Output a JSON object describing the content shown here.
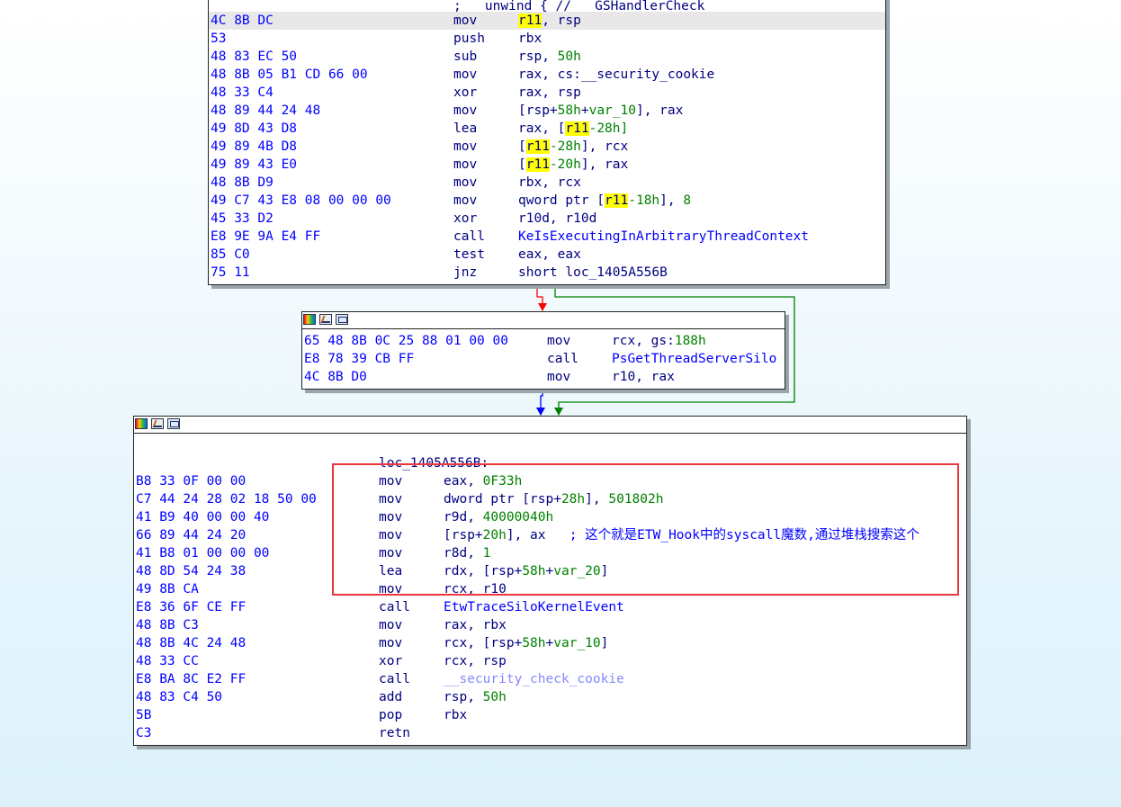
{
  "node1": {
    "partial_top": "; __unwind { // __GSHandlerCheck",
    "rows": [
      {
        "bytes": "4C 8B DC",
        "mnem": "mov",
        "op_parts": [
          {
            "t": "r11",
            "c": "hl"
          },
          {
            "t": ", rsp"
          }
        ]
      },
      {
        "bytes": "53",
        "mnem": "push",
        "op_parts": [
          {
            "t": "rbx"
          }
        ]
      },
      {
        "bytes": "48 83 EC 50",
        "mnem": "sub",
        "op_parts": [
          {
            "t": "rsp, "
          },
          {
            "t": "50h",
            "c": "g"
          }
        ]
      },
      {
        "bytes": "48 8B 05 B1 CD 66 00",
        "mnem": "mov",
        "op_parts": [
          {
            "t": "rax, cs:__security_cookie"
          }
        ]
      },
      {
        "bytes": "48 33 C4",
        "mnem": "xor",
        "op_parts": [
          {
            "t": "rax, rsp"
          }
        ]
      },
      {
        "bytes": "48 89 44 24 48",
        "mnem": "mov",
        "op_parts": [
          {
            "t": "[rsp+"
          },
          {
            "t": "58h",
            "c": "g"
          },
          {
            "t": "+"
          },
          {
            "t": "var_10",
            "c": "g"
          },
          {
            "t": "], rax"
          }
        ]
      },
      {
        "bytes": "49 8D 43 D8",
        "mnem": "lea",
        "op_parts": [
          {
            "t": "rax, ["
          },
          {
            "t": "r11",
            "c": "hl"
          },
          {
            "t": "-28h]",
            "c": "g"
          }
        ]
      },
      {
        "bytes": "49 89 4B D8",
        "mnem": "mov",
        "op_parts": [
          {
            "t": "["
          },
          {
            "t": "r11",
            "c": "hl"
          },
          {
            "t": "-28h",
            "c": "g"
          },
          {
            "t": "], rcx"
          }
        ]
      },
      {
        "bytes": "49 89 43 E0",
        "mnem": "mov",
        "op_parts": [
          {
            "t": "["
          },
          {
            "t": "r11",
            "c": "hl"
          },
          {
            "t": "-20h",
            "c": "g"
          },
          {
            "t": "], rax"
          }
        ]
      },
      {
        "bytes": "48 8B D9",
        "mnem": "mov",
        "op_parts": [
          {
            "t": "rbx, rcx"
          }
        ]
      },
      {
        "bytes": "49 C7 43 E8 08 00 00 00",
        "mnem": "mov",
        "op_parts": [
          {
            "t": "qword ptr ["
          },
          {
            "t": "r11",
            "c": "hl"
          },
          {
            "t": "-18h",
            "c": "g"
          },
          {
            "t": "], "
          },
          {
            "t": "8",
            "c": "g"
          }
        ]
      },
      {
        "bytes": "45 33 D2",
        "mnem": "xor",
        "op_parts": [
          {
            "t": "r10d, r10d"
          }
        ]
      },
      {
        "bytes": "E8 9E 9A E4 FF",
        "mnem": "call",
        "op_parts": [
          {
            "t": "KeIsExecutingInArbitraryThreadContext",
            "c": "b"
          }
        ]
      },
      {
        "bytes": "85 C0",
        "mnem": "test",
        "op_parts": [
          {
            "t": "eax, eax"
          }
        ]
      },
      {
        "bytes": "75 11",
        "mnem": "jnz",
        "op_parts": [
          {
            "t": "short loc_1405A556B"
          }
        ]
      }
    ]
  },
  "node2": {
    "rows": [
      {
        "bytes": "65 48 8B 0C 25 88 01 00 00",
        "mnem": "mov",
        "op_parts": [
          {
            "t": "rcx, gs:"
          },
          {
            "t": "188h",
            "c": "g"
          }
        ]
      },
      {
        "bytes": "E8 78 39 CB FF",
        "mnem": "call",
        "op_parts": [
          {
            "t": "PsGetThreadServerSilo",
            "c": "b"
          }
        ]
      },
      {
        "bytes": "4C 8B D0",
        "mnem": "mov",
        "op_parts": [
          {
            "t": "r10, rax"
          }
        ]
      }
    ]
  },
  "node3": {
    "label": "loc_1405A556B:",
    "rows": [
      {
        "bytes": "B8 33 0F 00 00",
        "mnem": "mov",
        "op_parts": [
          {
            "t": "eax, "
          },
          {
            "t": "0F33h",
            "c": "g"
          }
        ]
      },
      {
        "bytes": "C7 44 24 28 02 18 50 00",
        "mnem": "mov",
        "op_parts": [
          {
            "t": "dword ptr [rsp+"
          },
          {
            "t": "28h",
            "c": "g"
          },
          {
            "t": "], "
          },
          {
            "t": "501802h",
            "c": "g"
          }
        ]
      },
      {
        "bytes": "41 B9 40 00 00 40",
        "mnem": "mov",
        "op_parts": [
          {
            "t": "r9d, "
          },
          {
            "t": "40000040h",
            "c": "g"
          }
        ]
      },
      {
        "bytes": "66 89 44 24 20",
        "mnem": "mov",
        "op_parts": [
          {
            "t": "[rsp+"
          },
          {
            "t": "20h",
            "c": "g"
          },
          {
            "t": "], ax   "
          },
          {
            "t": "; 这个就是ETW_Hook中的syscall魔数,通过堆栈搜索这个",
            "c": "c"
          }
        ]
      },
      {
        "bytes": "41 B8 01 00 00 00",
        "mnem": "mov",
        "op_parts": [
          {
            "t": "r8d, "
          },
          {
            "t": "1",
            "c": "g"
          }
        ]
      },
      {
        "bytes": "48 8D 54 24 38",
        "mnem": "lea",
        "op_parts": [
          {
            "t": "rdx, [rsp+"
          },
          {
            "t": "58h",
            "c": "g"
          },
          {
            "t": "+"
          },
          {
            "t": "var_20",
            "c": "g"
          },
          {
            "t": "]"
          }
        ]
      },
      {
        "bytes": "49 8B CA",
        "mnem": "mov",
        "op_parts": [
          {
            "t": "rcx, r10"
          }
        ]
      },
      {
        "bytes": "E8 36 6F CE FF",
        "mnem": "call",
        "op_parts": [
          {
            "t": "EtwTraceSiloKernelEvent",
            "c": "b"
          }
        ]
      },
      {
        "bytes": "48 8B C3",
        "mnem": "mov",
        "op_parts": [
          {
            "t": "rax, rbx"
          }
        ]
      },
      {
        "bytes": "48 8B 4C 24 48",
        "mnem": "mov",
        "op_parts": [
          {
            "t": "rcx, [rsp+"
          },
          {
            "t": "58h",
            "c": "g"
          },
          {
            "t": "+"
          },
          {
            "t": "var_10",
            "c": "g"
          },
          {
            "t": "]"
          }
        ]
      },
      {
        "bytes": "48 33 CC",
        "mnem": "xor",
        "op_parts": [
          {
            "t": "rcx, rsp"
          }
        ]
      },
      {
        "bytes": "E8 BA 8C E2 FF",
        "mnem": "call",
        "op_parts": [
          {
            "t": "__security_check_cookie",
            "c": "ref"
          }
        ]
      },
      {
        "bytes": "48 83 C4 50",
        "mnem": "add",
        "op_parts": [
          {
            "t": "rsp, "
          },
          {
            "t": "50h",
            "c": "g"
          }
        ]
      },
      {
        "bytes": "5B",
        "mnem": "pop",
        "op_parts": [
          {
            "t": "rbx"
          }
        ]
      },
      {
        "bytes": "C3",
        "mnem": "retn",
        "op_parts": []
      }
    ]
  },
  "icons": [
    "color-palette-icon",
    "edit-graph-icon",
    "grouping-icon"
  ],
  "colors": {
    "edge_false": "#ff0000",
    "edge_true": "#008000",
    "edge_direct": "#0000ff",
    "annotation_box": "#e8383d",
    "highlight": "#ffff00"
  }
}
